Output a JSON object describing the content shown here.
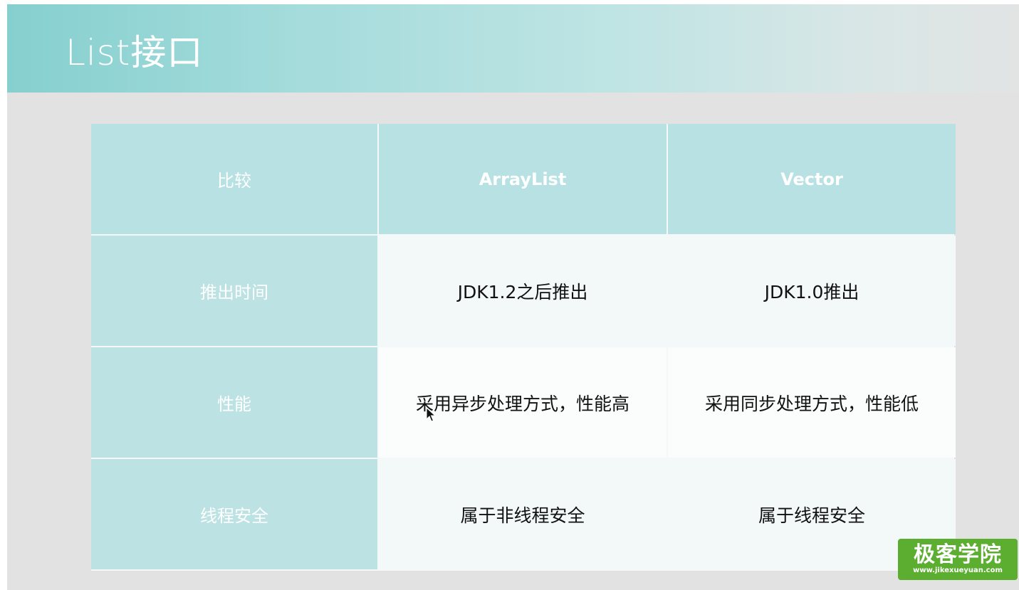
{
  "slide": {
    "title": "List接口"
  },
  "table": {
    "headers": [
      "比较",
      "ArrayList",
      "Vector"
    ],
    "rows": [
      {
        "label": "推出时间",
        "arraylist": "JDK1.2之后推出",
        "vector": "JDK1.0推出"
      },
      {
        "label": "性能",
        "arraylist": "采用异步处理方式，性能高",
        "vector": "采用同步处理方式，性能低"
      },
      {
        "label": "线程安全",
        "arraylist": "属于非线程安全",
        "vector": "属于线程安全"
      }
    ]
  },
  "logo": {
    "text": "极客学院",
    "url": "www.jikexueyuan.com"
  },
  "colors": {
    "title_bar": "#86cfcf",
    "header_cell": "#b7e1e3",
    "row_label_cell": "#bde2e4",
    "data_cell": "#f3f9f9",
    "logo_bg": "#5cae31"
  },
  "icons": {
    "cursor": "mouse-pointer-icon"
  }
}
